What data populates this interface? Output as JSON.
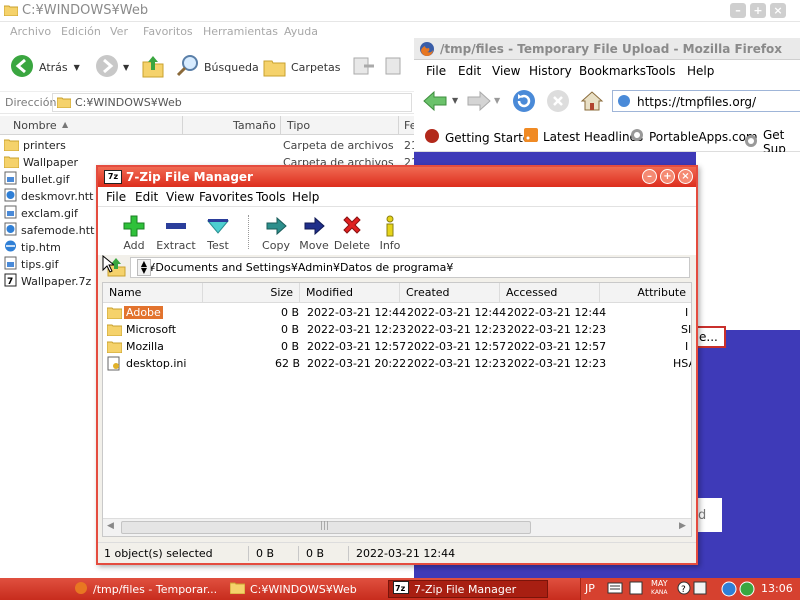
{
  "explorer": {
    "title": "C:¥WINDOWS¥Web",
    "menu": [
      "Archivo",
      "Edición",
      "Ver",
      "Favoritos",
      "Herramientas",
      "Ayuda"
    ],
    "toolbar": {
      "back": "Atrás",
      "search": "Búsqueda",
      "folders": "Carpetas"
    },
    "address_label": "Dirección",
    "address": "C:¥WINDOWS¥Web",
    "columns": [
      "Nombre",
      "Tamaño",
      "Tipo",
      "Fe"
    ],
    "files": [
      {
        "name": "printers",
        "type": "Carpeta de archivos",
        "date": "21",
        "icon": "folder-icon"
      },
      {
        "name": "Wallpaper",
        "type": "Carpeta de archivos",
        "date": "21",
        "icon": "folder-icon"
      },
      {
        "name": "bullet.gif",
        "icon": "image-icon"
      },
      {
        "name": "deskmovr.htt",
        "icon": "ie-icon"
      },
      {
        "name": "exclam.gif",
        "icon": "image-icon"
      },
      {
        "name": "safemode.htt",
        "icon": "ie-icon"
      },
      {
        "name": "tip.htm",
        "icon": "ie-icon"
      },
      {
        "name": "tips.gif",
        "icon": "image-icon"
      },
      {
        "name": "Wallpaper.7z",
        "icon": "7z-icon"
      }
    ]
  },
  "firefox": {
    "title": "/tmp/files - Temporary File Upload - Mozilla Firefox",
    "menu": [
      "File",
      "Edit",
      "View",
      "History",
      "Bookmarks",
      "Tools",
      "Help"
    ],
    "url": "https://tmpfiles.org/",
    "bookmarks": [
      "Getting Started",
      "Latest Headlines",
      "PortableApps.com",
      "Get Sup"
    ],
    "content_button": "e...",
    "content_text": "d"
  },
  "zip": {
    "title": "7-Zip File Manager",
    "menu": [
      "File",
      "Edit",
      "View",
      "Favorites",
      "Tools",
      "Help"
    ],
    "tools": [
      "Add",
      "Extract",
      "Test",
      "Copy",
      "Move",
      "Delete",
      "Info"
    ],
    "path": "C:¥Documents and Settings¥Admin¥Datos de programa¥",
    "columns": [
      "Name",
      "Size",
      "Modified",
      "Created",
      "Accessed",
      "Attribute"
    ],
    "rows": [
      {
        "name": "Adobe",
        "size": "0 B",
        "modified": "2022-03-21 12:44",
        "created": "2022-03-21 12:44",
        "accessed": "2022-03-21 12:44",
        "attr": "I",
        "selected": true,
        "icon": "folder-icon"
      },
      {
        "name": "Microsoft",
        "size": "0 B",
        "modified": "2022-03-21 12:23",
        "created": "2022-03-21 12:23",
        "accessed": "2022-03-21 12:23",
        "attr": "SI",
        "selected": false,
        "icon": "folder-icon"
      },
      {
        "name": "Mozilla",
        "size": "0 B",
        "modified": "2022-03-21 12:57",
        "created": "2022-03-21 12:57",
        "accessed": "2022-03-21 12:57",
        "attr": "I",
        "selected": false,
        "icon": "folder-icon"
      },
      {
        "name": "desktop.ini",
        "size": "62 B",
        "modified": "2022-03-21 20:22",
        "created": "2022-03-21 12:23",
        "accessed": "2022-03-21 12:23",
        "attr": "HSA",
        "selected": false,
        "icon": "ini-file-icon"
      }
    ],
    "status": {
      "selected": "1 object(s) selected",
      "size": "0 B",
      "packed": "0 B",
      "date": "2022-03-21 12:44"
    }
  },
  "taskbar": {
    "tasks": [
      "/tmp/files - Temporar...",
      "C:¥WINDOWS¥Web",
      "7-Zip File Manager"
    ],
    "lang": "JP",
    "ime": "MAY",
    "ime2": "KANA",
    "clock": "13:06"
  },
  "colors": {
    "accent": "#dd2d1d",
    "selection": "#e2732e",
    "firefox_bg": "#3e3ab8"
  }
}
